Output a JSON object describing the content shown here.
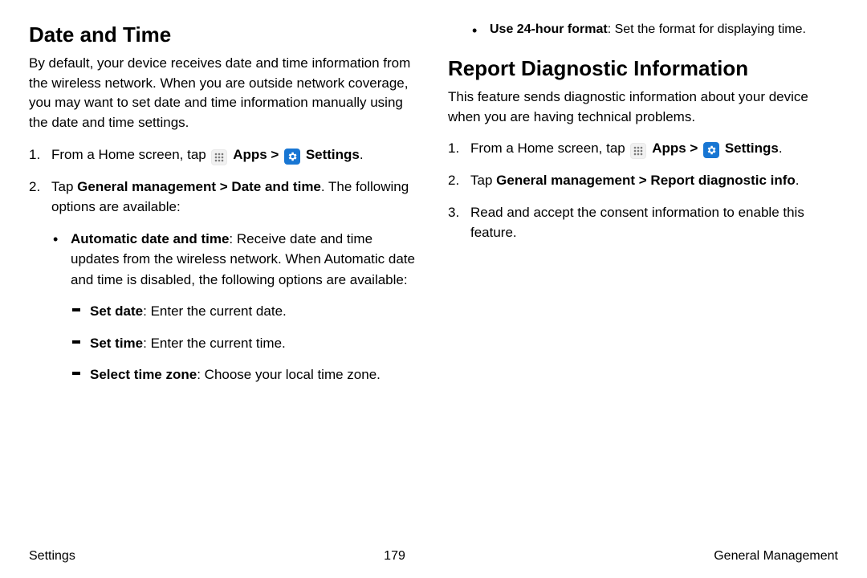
{
  "left": {
    "heading": "Date and Time",
    "intro": "By default, your device receives date and time information from the wireless network. When you are outside network coverage, you may want to set date and time information manually using the date and time settings.",
    "step1_prefix": "From a Home screen, tap ",
    "step1_apps": "Apps",
    "step1_sep": " > ",
    "step1_settings": "Settings",
    "step1_suffix": ".",
    "step2_prefix": "Tap ",
    "step2_bold": "General management > Date and time",
    "step2_suffix": ". The following options are available:",
    "bullet1_bold": "Automatic date and time",
    "bullet1_rest": ": Receive date and time updates from the wireless network. When Automatic date and time is disabled, the following options are available:",
    "dash1_bold": "Set date",
    "dash1_rest": ": Enter the current date.",
    "dash2_bold": "Set time",
    "dash2_rest": ": Enter the current time.",
    "dash3_bold": "Select time zone",
    "dash3_rest": ": Choose your local time zone."
  },
  "right": {
    "topbullet_bold": "Use 24-hour format",
    "topbullet_rest": ": Set the format for displaying time.",
    "heading": "Report Diagnostic Information",
    "intro": "This feature sends diagnostic information about your device when you are having technical problems.",
    "step1_prefix": "From a Home screen, tap ",
    "step1_apps": "Apps",
    "step1_sep": " > ",
    "step1_settings": "Settings",
    "step1_suffix": ".",
    "step2_prefix": "Tap ",
    "step2_bold": "General management > Report diagnostic info",
    "step2_suffix": ".",
    "step3": "Read and accept the consent information to enable this feature."
  },
  "footer": {
    "left": "Settings",
    "center": "179",
    "right": "General Management"
  }
}
